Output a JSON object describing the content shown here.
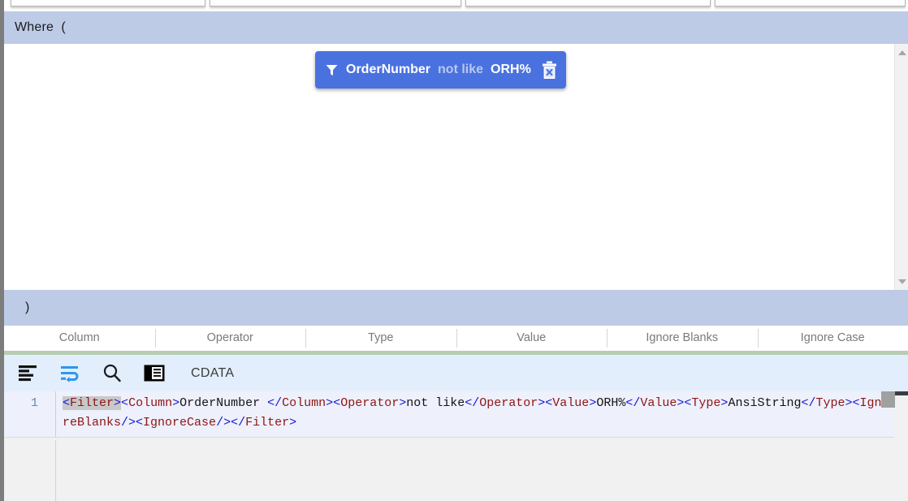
{
  "window": {
    "top_tabs": [
      {
        "label": ""
      },
      {
        "label": ""
      },
      {
        "label": ""
      },
      {
        "label": ""
      }
    ]
  },
  "where_band": {
    "label": "Where  ("
  },
  "close_band": {
    "label": ")"
  },
  "filter_chip": {
    "column": "OrderNumber",
    "operator": "not like",
    "value": "ORH%",
    "funnel_icon": "filter-funnel-icon",
    "delete_icon": "trash-delete-icon",
    "background_color": "#4a72df",
    "operator_color": "#b9c8ef"
  },
  "column_headers": [
    "Column",
    "Operator",
    "Type",
    "Value",
    "Ignore Blanks",
    "Ignore Case"
  ],
  "editor_toolbar": {
    "icons": [
      "format-indent-icon",
      "word-wrap-icon",
      "search-icon",
      "split-panel-icon"
    ],
    "label": "CDATA"
  },
  "code_editor": {
    "line_number": "1",
    "full_text": "<Filter><Column>OrderNumber </Column><Operator>not like</Operator><Value>ORH%</Value><Type>AnsiString</Type><IgnoreBlanks/><IgnoreCase/></Filter>",
    "tokens": [
      {
        "t": "<",
        "c": "br",
        "hl": true
      },
      {
        "t": "Filter",
        "c": "name",
        "hl": true
      },
      {
        "t": ">",
        "c": "br",
        "hl": true
      },
      {
        "t": "<",
        "c": "br"
      },
      {
        "t": "Column",
        "c": "name"
      },
      {
        "t": ">",
        "c": "br"
      },
      {
        "t": "OrderNumber ",
        "c": "txt"
      },
      {
        "t": "</",
        "c": "br"
      },
      {
        "t": "Column",
        "c": "name"
      },
      {
        "t": ">",
        "c": "br"
      },
      {
        "t": "<",
        "c": "br"
      },
      {
        "t": "Operator",
        "c": "name"
      },
      {
        "t": ">",
        "c": "br"
      },
      {
        "t": "not like",
        "c": "txt"
      },
      {
        "t": "</",
        "c": "br"
      },
      {
        "t": "Operator",
        "c": "name"
      },
      {
        "t": ">",
        "c": "br"
      },
      {
        "t": "<",
        "c": "br"
      },
      {
        "t": "Value",
        "c": "name"
      },
      {
        "t": ">",
        "c": "br"
      },
      {
        "t": "ORH%",
        "c": "txt"
      },
      {
        "t": "</",
        "c": "br"
      },
      {
        "t": "Value",
        "c": "name"
      },
      {
        "t": ">",
        "c": "br"
      },
      {
        "t": "<",
        "c": "br"
      },
      {
        "t": "Type",
        "c": "name"
      },
      {
        "t": ">",
        "c": "br"
      },
      {
        "t": "AnsiString",
        "c": "txt"
      },
      {
        "t": "</",
        "c": "br"
      },
      {
        "t": "Type",
        "c": "name"
      },
      {
        "t": ">",
        "c": "br"
      },
      {
        "t": "<",
        "c": "br"
      },
      {
        "t": "IgnoreBlanks",
        "c": "name"
      },
      {
        "t": "/>",
        "c": "br"
      },
      {
        "t": "<",
        "c": "br"
      },
      {
        "t": "IgnoreCase",
        "c": "name"
      },
      {
        "t": "/>",
        "c": "br"
      },
      {
        "t": "</",
        "c": "br"
      },
      {
        "t": "Filter",
        "c": "name"
      },
      {
        "t": ">",
        "c": "br"
      }
    ]
  },
  "colors": {
    "band_blue": "#bdcbe6",
    "toolbar_blue": "#e2eefb",
    "green_separator": "#b6cdb1",
    "code_line_bg": "#eef0fb",
    "chip_blue": "#4a72df"
  }
}
